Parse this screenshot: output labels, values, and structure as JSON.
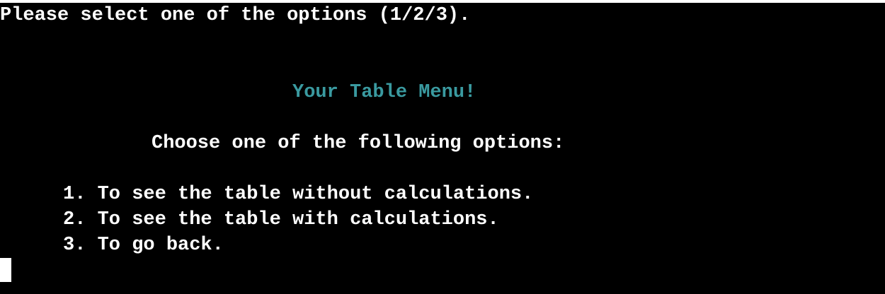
{
  "terminal": {
    "prompt": "Please select one of the options (1/2/3).",
    "menu_title": "Your Table Menu!",
    "menu_subtitle": "Choose one of the following options:",
    "options": [
      "1. To see the table without calculations.",
      "2. To see the table with calculations.",
      "3. To go back."
    ]
  },
  "colors": {
    "background": "#000000",
    "text": "#ffffff",
    "title": "#3a9aa0"
  }
}
